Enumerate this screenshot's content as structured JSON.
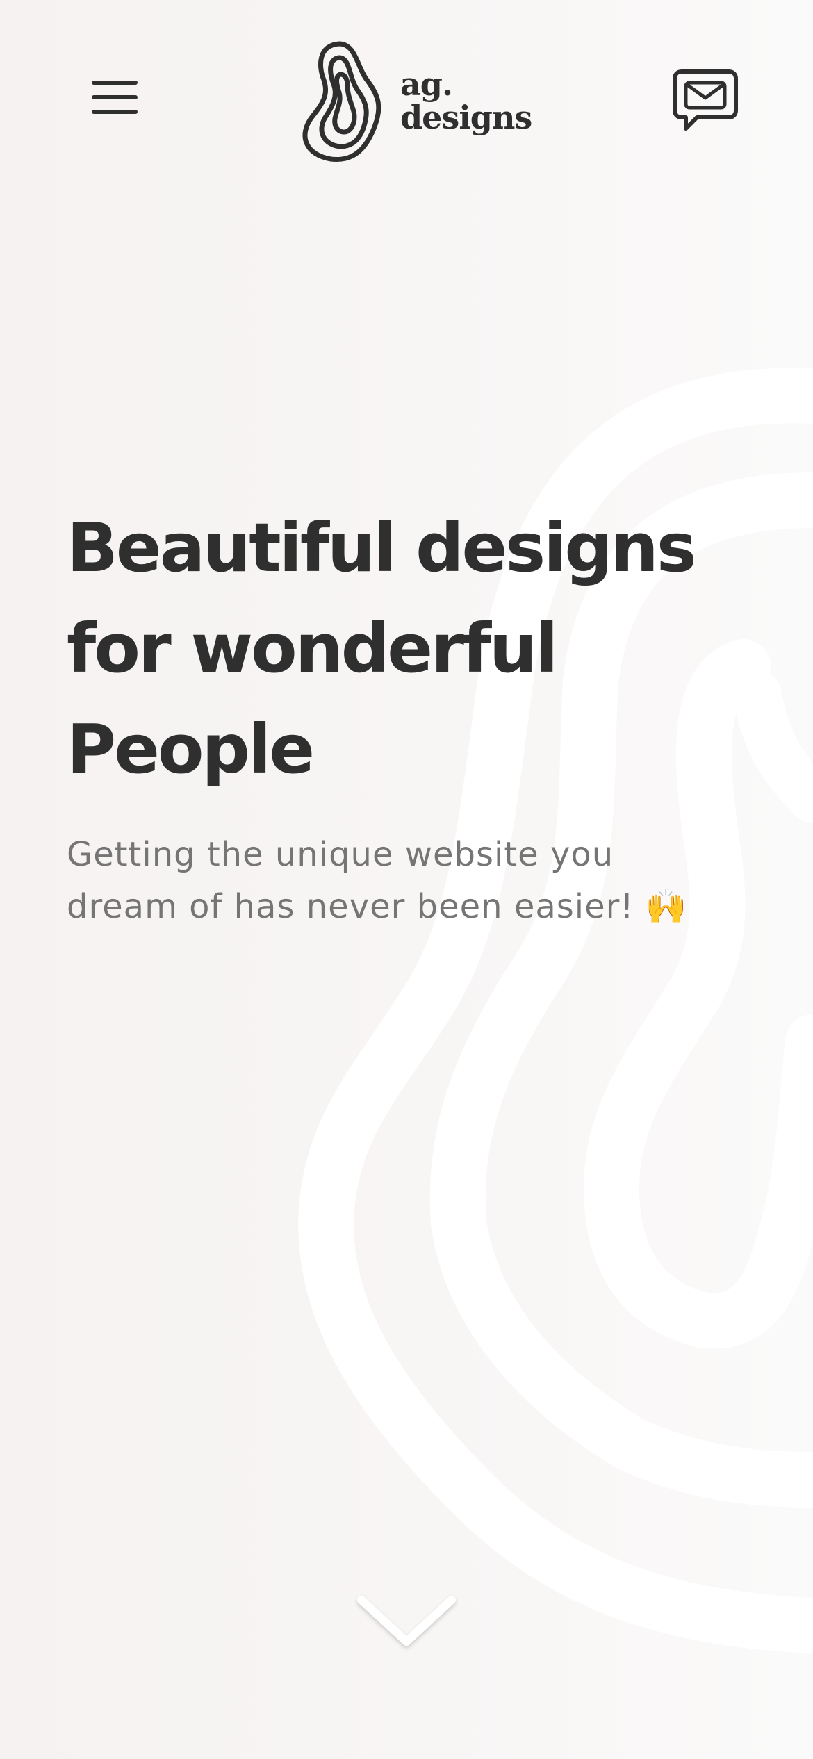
{
  "header": {
    "menu_icon": "hamburger-menu-icon",
    "logo": {
      "icon": "topographic-contour-logo-icon",
      "line1": "ag.",
      "line2": "designs"
    },
    "contact_icon": "message-envelope-icon"
  },
  "hero": {
    "title_lines": [
      "Beautiful designs",
      "for wonderful",
      "People"
    ],
    "subtitle_lines": [
      "Getting the unique website you",
      "dream of has never been easier! 🙌"
    ]
  },
  "scroll": {
    "icon": "chevron-down-icon"
  },
  "colors": {
    "text_dark": "#2f2f2f",
    "text_muted": "#757575",
    "background": "#f7f4f3",
    "decor": "#ffffff"
  }
}
